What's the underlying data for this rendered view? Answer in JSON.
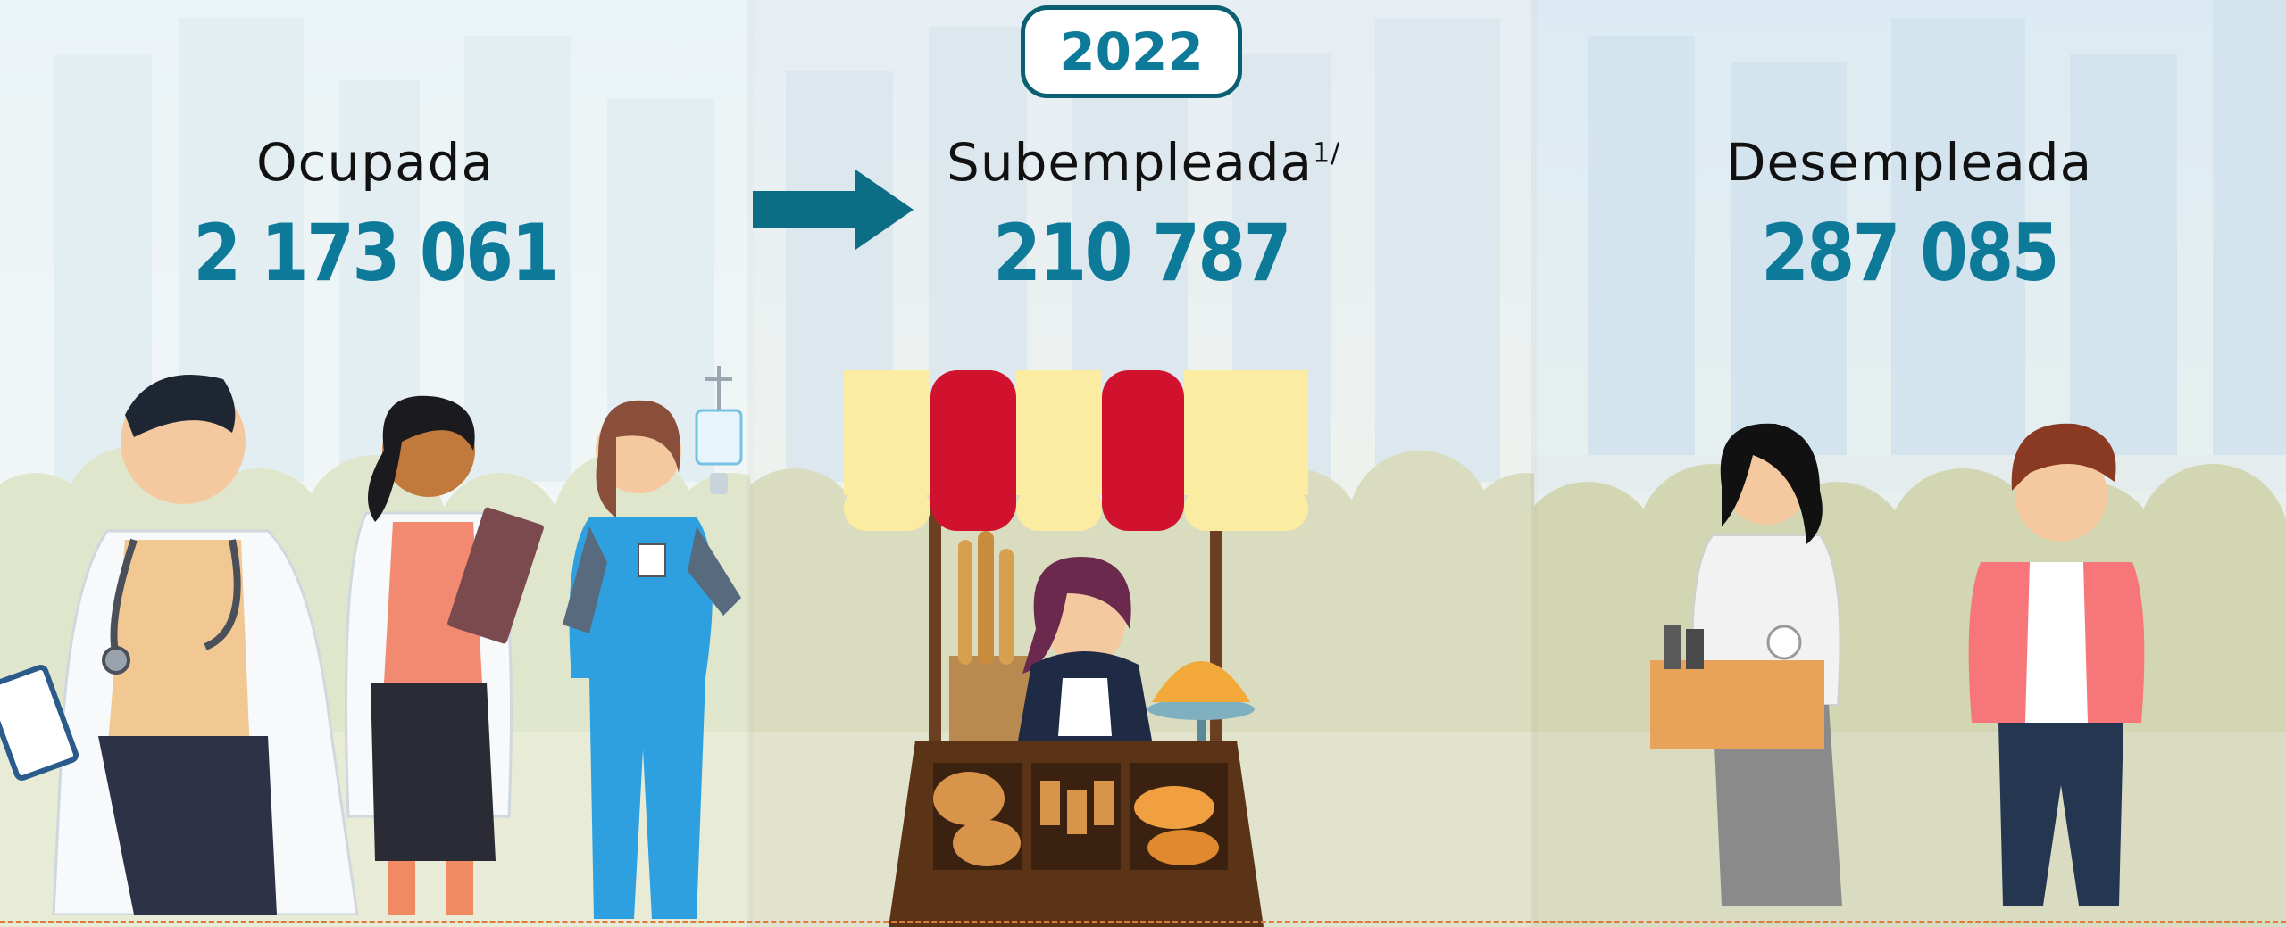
{
  "year": "2022",
  "categories": [
    {
      "label": "Ocupada",
      "value": "2 173 061"
    },
    {
      "label": "Subempleada",
      "footnote": "1/",
      "value": "210 787"
    },
    {
      "label": "Desempleada",
      "value": "287 085"
    }
  ],
  "colors": {
    "number": "#0e7a99",
    "badge_border": "#0b5f72",
    "arrow": "#0b6e85",
    "awning_red": "#d0122e",
    "awning_cream": "#fbeca2",
    "dashed_line": "#e07a3b"
  },
  "icons": [
    "right-arrow-icon",
    "bakery-stall-illustration",
    "health-workers-illustration",
    "unemployed-people-illustration"
  ]
}
